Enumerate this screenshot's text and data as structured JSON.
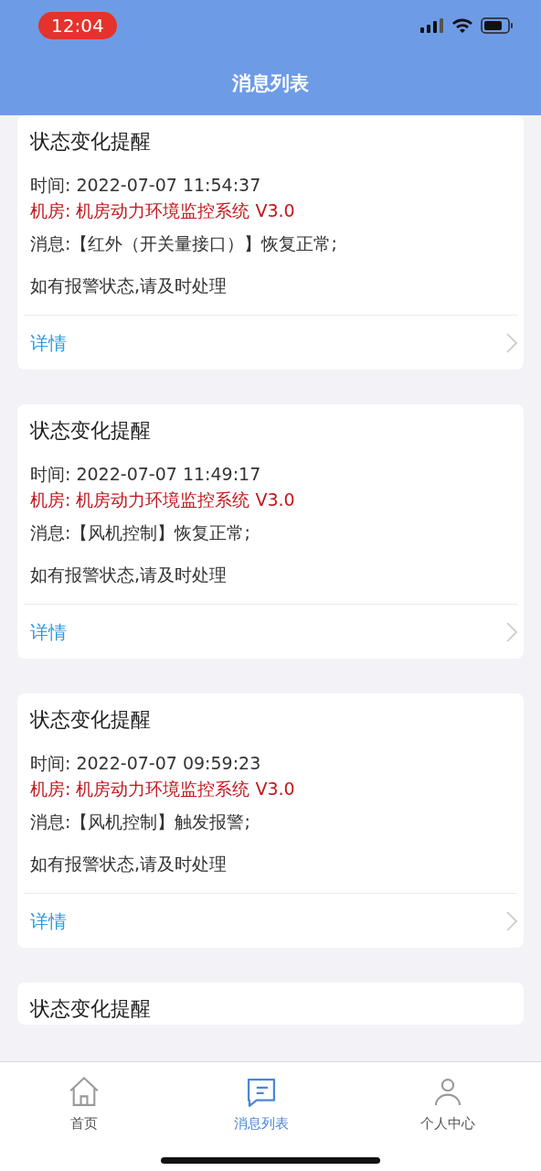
{
  "status_bar": {
    "time": "12:04"
  },
  "header": {
    "title": "消息列表"
  },
  "messages": [
    {
      "title": "状态变化提醒",
      "time": "时间:  2022-07-07 11:54:37",
      "room": "机房:  机房动力环境监控系统 V3.0",
      "message": "消息:【红外（开关量接口）】恢复正常;",
      "hint": "如有报警状态,请及时处理",
      "detail": "详情"
    },
    {
      "title": "状态变化提醒",
      "time": "时间:  2022-07-07 11:49:17",
      "room": "机房:  机房动力环境监控系统 V3.0",
      "message": "消息:【风机控制】恢复正常;",
      "hint": "如有报警状态,请及时处理",
      "detail": "详情"
    },
    {
      "title": "状态变化提醒",
      "time": "时间:  2022-07-07 09:59:23",
      "room": "机房:  机房动力环境监控系统 V3.0",
      "message": "消息:【风机控制】触发报警;",
      "hint": "如有报警状态,请及时处理",
      "detail": "详情"
    },
    {
      "title": "状态变化提醒"
    }
  ],
  "tab_bar": [
    {
      "label": "首页",
      "kind": "home",
      "selected": false
    },
    {
      "label": "消息列表",
      "kind": "messages",
      "selected": true
    },
    {
      "label": "个人中心",
      "kind": "profile",
      "selected": false
    }
  ]
}
